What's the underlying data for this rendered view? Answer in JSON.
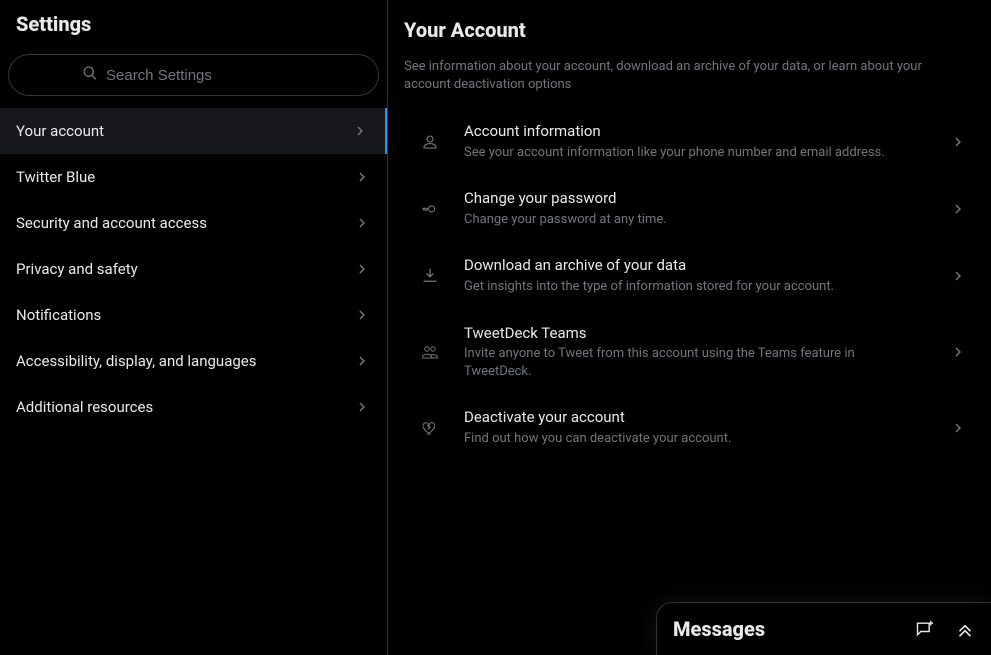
{
  "sidebar": {
    "title": "Settings",
    "search_placeholder": "Search Settings",
    "items": [
      {
        "label": "Your account",
        "active": true
      },
      {
        "label": "Twitter Blue"
      },
      {
        "label": "Security and account access"
      },
      {
        "label": "Privacy and safety"
      },
      {
        "label": "Notifications"
      },
      {
        "label": "Accessibility, display, and languages"
      },
      {
        "label": "Additional resources"
      }
    ]
  },
  "main": {
    "title": "Your Account",
    "description": "See information about your account, download an archive of your data, or learn about your account deactivation options",
    "options": [
      {
        "icon": "person-icon",
        "label": "Account information",
        "sub": "See your account information like your phone number and email address."
      },
      {
        "icon": "key-icon",
        "label": "Change your password",
        "sub": "Change your password at any time."
      },
      {
        "icon": "download-icon",
        "label": "Download an archive of your data",
        "sub": "Get insights into the type of information stored for your account."
      },
      {
        "icon": "people-icon",
        "label": "TweetDeck Teams",
        "sub": "Invite anyone to Tweet from this account using the Teams feature in TweetDeck."
      },
      {
        "icon": "heart-broken-icon",
        "label": "Deactivate your account",
        "sub": "Find out how you can deactivate your account."
      }
    ]
  },
  "messages": {
    "title": "Messages"
  }
}
